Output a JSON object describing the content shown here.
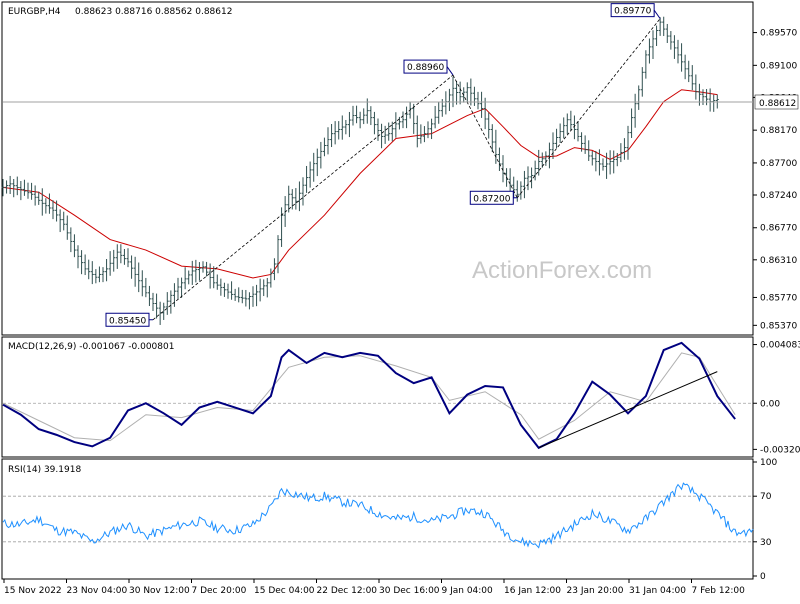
{
  "chart_data": [
    {
      "type": "ohlc",
      "title": "EURGBP,H4",
      "ohlc_text": "0.88623 0.88716 0.88562 0.88612",
      "current_price": 0.88612,
      "current_price_label": "0.88612",
      "ylim": [
        0.8526,
        0.8998
      ],
      "y_ticks": [
        0.8537,
        0.8577,
        0.8631,
        0.8677,
        0.8724,
        0.877,
        0.8817,
        0.8864,
        0.891,
        0.8957
      ],
      "y_tick_labels": [
        "0.85370",
        "0.85770",
        "0.86310",
        "0.86770",
        "0.87240",
        "0.87700",
        "0.88170",
        "0.88640",
        "0.89100",
        "0.89570"
      ],
      "x_ticks": [
        "15 Nov 2022",
        "23 Nov 04:00",
        "30 Nov 12:00",
        "7 Dec 20:00",
        "15 Dec 04:00",
        "22 Dec 12:00",
        "30 Dec 16:00",
        "9 Jan 04:00",
        "16 Jan 12:00",
        "23 Jan 20:00",
        "31 Jan 04:00",
        "7 Feb 12:00"
      ],
      "close_path": [
        [
          0,
          0.8735
        ],
        [
          2,
          0.874
        ],
        [
          5,
          0.8732
        ],
        [
          8,
          0.8725
        ],
        [
          11,
          0.8712
        ],
        [
          14,
          0.8702
        ],
        [
          17,
          0.8682
        ],
        [
          20,
          0.8645
        ],
        [
          23,
          0.8618
        ],
        [
          26,
          0.8606
        ],
        [
          29,
          0.8618
        ],
        [
          32,
          0.8642
        ],
        [
          35,
          0.8628
        ],
        [
          38,
          0.8601
        ],
        [
          41,
          0.8575
        ],
        [
          44,
          0.8555
        ],
        [
          47,
          0.858
        ],
        [
          50,
          0.8598
        ],
        [
          53,
          0.8615
        ],
        [
          56,
          0.8621
        ],
        [
          59,
          0.8598
        ],
        [
          62,
          0.8588
        ],
        [
          65,
          0.8578
        ],
        [
          68,
          0.8575
        ],
        [
          71,
          0.8585
        ],
        [
          74,
          0.8598
        ],
        [
          76,
          0.8625
        ],
        [
          78,
          0.8695
        ],
        [
          80,
          0.8725
        ],
        [
          82,
          0.8715
        ],
        [
          84,
          0.8738
        ],
        [
          86,
          0.876
        ],
        [
          88,
          0.8778
        ],
        [
          90,
          0.8795
        ],
        [
          92,
          0.8812
        ],
        [
          94,
          0.8818
        ],
        [
          96,
          0.8825
        ],
        [
          98,
          0.8838
        ],
        [
          100,
          0.8832
        ],
        [
          102,
          0.8845
        ],
        [
          104,
          0.8825
        ],
        [
          106,
          0.8808
        ],
        [
          108,
          0.8812
        ],
        [
          110,
          0.8826
        ],
        [
          112,
          0.8832
        ],
        [
          114,
          0.8848
        ],
        [
          116,
          0.8805
        ],
        [
          118,
          0.8812
        ],
        [
          120,
          0.8826
        ],
        [
          122,
          0.8845
        ],
        [
          124,
          0.8858
        ],
        [
          126,
          0.8877
        ],
        [
          128,
          0.8865
        ],
        [
          130,
          0.8878
        ],
        [
          132,
          0.8862
        ],
        [
          134,
          0.8848
        ],
        [
          136,
          0.8818
        ],
        [
          138,
          0.8782
        ],
        [
          140,
          0.8755
        ],
        [
          142,
          0.8738
        ],
        [
          144,
          0.8725
        ],
        [
          146,
          0.8748
        ],
        [
          148,
          0.8752
        ],
        [
          150,
          0.8772
        ],
        [
          152,
          0.878
        ],
        [
          154,
          0.8798
        ],
        [
          156,
          0.8815
        ],
        [
          158,
          0.8832
        ],
        [
          160,
          0.8818
        ],
        [
          162,
          0.8798
        ],
        [
          164,
          0.878
        ],
        [
          166,
          0.8772
        ],
        [
          168,
          0.8765
        ],
        [
          170,
          0.8772
        ],
        [
          172,
          0.8778
        ],
        [
          174,
          0.8792
        ],
        [
          176,
          0.8835
        ],
        [
          178,
          0.8875
        ],
        [
          180,
          0.8925
        ],
        [
          182,
          0.8948
        ],
        [
          184,
          0.8972
        ],
        [
          186,
          0.8952
        ],
        [
          188,
          0.8935
        ],
        [
          190,
          0.8915
        ],
        [
          192,
          0.8895
        ],
        [
          194,
          0.8872
        ],
        [
          196,
          0.8865
        ],
        [
          198,
          0.8858
        ],
        [
          200,
          0.8861
        ]
      ],
      "ma_path": [
        [
          0,
          0.8735
        ],
        [
          10,
          0.8728
        ],
        [
          20,
          0.8695
        ],
        [
          30,
          0.866
        ],
        [
          40,
          0.8645
        ],
        [
          50,
          0.8622
        ],
        [
          60,
          0.8618
        ],
        [
          70,
          0.8605
        ],
        [
          75,
          0.861
        ],
        [
          80,
          0.8645
        ],
        [
          90,
          0.8695
        ],
        [
          100,
          0.8755
        ],
        [
          110,
          0.8805
        ],
        [
          120,
          0.8812
        ],
        [
          130,
          0.8838
        ],
        [
          135,
          0.8848
        ],
        [
          140,
          0.8822
        ],
        [
          145,
          0.8795
        ],
        [
          150,
          0.8778
        ],
        [
          155,
          0.878
        ],
        [
          160,
          0.8792
        ],
        [
          165,
          0.8788
        ],
        [
          170,
          0.8775
        ],
        [
          175,
          0.8788
        ],
        [
          180,
          0.8822
        ],
        [
          185,
          0.8858
        ],
        [
          190,
          0.8875
        ],
        [
          195,
          0.8872
        ],
        [
          200,
          0.8868
        ]
      ],
      "annotations": [
        {
          "label": "0.85450",
          "x": 42,
          "y": 0.8545
        },
        {
          "label": "0.88960",
          "x": 126,
          "y": 0.8896
        },
        {
          "label": "0.87200",
          "x": 144,
          "y": 0.872
        },
        {
          "label": "0.89770",
          "x": 184,
          "y": 0.8977
        }
      ],
      "trend_lines": [
        {
          "from": [
            42,
            0.8545
          ],
          "to": [
            126,
            0.8896
          ],
          "style": "dashed",
          "color": "#000000"
        },
        {
          "from": [
            126,
            0.8896
          ],
          "to": [
            144,
            0.872
          ],
          "style": "dashed",
          "color": "#000000"
        },
        {
          "from": [
            144,
            0.872
          ],
          "to": [
            184,
            0.8977
          ],
          "style": "dashed",
          "color": "#000000"
        }
      ],
      "colors": {
        "bars": "#2f4f4f",
        "ma": "#cc0000",
        "grid": "#c0c0c0"
      },
      "watermark": "ActionForex.com"
    },
    {
      "type": "line",
      "title": "MACD(12,26,9) -0.001067 -0.000801",
      "ylim": [
        -0.0036,
        0.0044
      ],
      "y_ticks": [
        0.004083,
        0.0,
        -0.003209
      ],
      "y_tick_labels": [
        "0.004083",
        "0.00",
        "-0.003209"
      ],
      "zero_line": 0.0,
      "series": [
        {
          "values": [
            [
              0,
              -0.0001
            ],
            [
              5,
              -0.0008
            ],
            [
              10,
              -0.0018
            ],
            [
              15,
              -0.0022
            ],
            [
              20,
              -0.0027
            ],
            [
              25,
              -0.003
            ],
            [
              30,
              -0.0024
            ],
            [
              35,
              -0.0005
            ],
            [
              40,
              0.0
            ],
            [
              45,
              -0.0007
            ],
            [
              50,
              -0.0015
            ],
            [
              55,
              -0.0003
            ],
            [
              60,
              0.0001
            ],
            [
              65,
              -0.0003
            ],
            [
              70,
              -0.0007
            ],
            [
              75,
              0.0005
            ],
            [
              78,
              0.0032
            ],
            [
              80,
              0.0037
            ],
            [
              85,
              0.0028
            ],
            [
              90,
              0.0035
            ],
            [
              95,
              0.0032
            ],
            [
              100,
              0.0035
            ],
            [
              105,
              0.0033
            ],
            [
              110,
              0.0021
            ],
            [
              115,
              0.0014
            ],
            [
              120,
              0.0018
            ],
            [
              125,
              -0.0007
            ],
            [
              130,
              0.0006
            ],
            [
              135,
              0.0012
            ],
            [
              140,
              0.0011
            ],
            [
              145,
              -0.0015
            ],
            [
              150,
              -0.0031
            ],
            [
              155,
              -0.0025
            ],
            [
              160,
              -0.0007
            ],
            [
              165,
              0.0015
            ],
            [
              170,
              0.0006
            ],
            [
              175,
              -0.0007
            ],
            [
              180,
              0.0005
            ],
            [
              185,
              0.0037
            ],
            [
              190,
              0.0042
            ],
            [
              195,
              0.0031
            ],
            [
              200,
              0.0005
            ],
            [
              205,
              -0.0011
            ]
          ],
          "color": "#000080"
        },
        {
          "values": [
            [
              0,
              0.0
            ],
            [
              10,
              -0.0012
            ],
            [
              20,
              -0.0024
            ],
            [
              30,
              -0.0026
            ],
            [
              40,
              -0.0008
            ],
            [
              50,
              -0.001
            ],
            [
              60,
              -0.0003
            ],
            [
              70,
              -0.0005
            ],
            [
              80,
              0.0025
            ],
            [
              90,
              0.0032
            ],
            [
              100,
              0.0033
            ],
            [
              110,
              0.0026
            ],
            [
              120,
              0.0018
            ],
            [
              125,
              0.0002
            ],
            [
              135,
              0.0008
            ],
            [
              145,
              -0.0008
            ],
            [
              150,
              -0.0025
            ],
            [
              160,
              -0.0012
            ],
            [
              170,
              0.0008
            ],
            [
              180,
              0.0001
            ],
            [
              190,
              0.0035
            ],
            [
              195,
              0.0032
            ],
            [
              200,
              0.0012
            ],
            [
              205,
              -0.0008
            ]
          ],
          "color": "#b0b0b0"
        }
      ],
      "trend_lines": [
        {
          "from": [
            150,
            -0.0031
          ],
          "to": [
            200,
            0.0022
          ],
          "style": "solid",
          "color": "#000000"
        }
      ]
    },
    {
      "type": "line",
      "title": "RSI(14) 39.1918",
      "ylim": [
        0,
        100
      ],
      "y_ticks": [
        100,
        70,
        30,
        0
      ],
      "y_tick_labels": [
        "100",
        "70",
        "30",
        "0"
      ],
      "levels": [
        70,
        30
      ],
      "series": [
        {
          "values": [
            [
              0,
              46
            ],
            [
              5,
              45
            ],
            [
              10,
              50
            ],
            [
              15,
              40
            ],
            [
              20,
              38
            ],
            [
              25,
              30
            ],
            [
              30,
              38
            ],
            [
              35,
              45
            ],
            [
              40,
              35
            ],
            [
              45,
              40
            ],
            [
              50,
              45
            ],
            [
              55,
              48
            ],
            [
              60,
              42
            ],
            [
              65,
              40
            ],
            [
              70,
              45
            ],
            [
              75,
              60
            ],
            [
              78,
              75
            ],
            [
              82,
              72
            ],
            [
              86,
              68
            ],
            [
              90,
              70
            ],
            [
              95,
              65
            ],
            [
              100,
              62
            ],
            [
              105,
              55
            ],
            [
              110,
              50
            ],
            [
              115,
              52
            ],
            [
              120,
              48
            ],
            [
              125,
              52
            ],
            [
              130,
              58
            ],
            [
              135,
              55
            ],
            [
              140,
              40
            ],
            [
              145,
              30
            ],
            [
              150,
              28
            ],
            [
              155,
              35
            ],
            [
              160,
              45
            ],
            [
              165,
              55
            ],
            [
              170,
              48
            ],
            [
              175,
              40
            ],
            [
              180,
              50
            ],
            [
              185,
              65
            ],
            [
              190,
              80
            ],
            [
              195,
              70
            ],
            [
              200,
              55
            ],
            [
              205,
              38
            ],
            [
              210,
              39
            ]
          ],
          "color": "#1e90ff"
        }
      ]
    }
  ]
}
